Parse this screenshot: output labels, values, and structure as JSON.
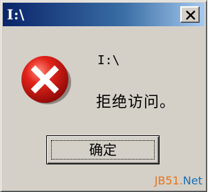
{
  "window": {
    "title": "I:\\"
  },
  "titlebar": {
    "close_icon": "close-x-icon"
  },
  "dialog": {
    "icon": "error-icon",
    "path": "I:\\",
    "message": "拒绝访问。",
    "ok_label": "确定"
  },
  "watermark": {
    "part1": "JB51.",
    "part2": "Net"
  },
  "colors": {
    "titlebar_start": "#0a246a",
    "titlebar_end": "#a6caf0",
    "face": "#d4d0c8",
    "error_red": "#d4141a",
    "watermark_orange": "#e8731a",
    "watermark_blue": "#1a6fb5"
  }
}
